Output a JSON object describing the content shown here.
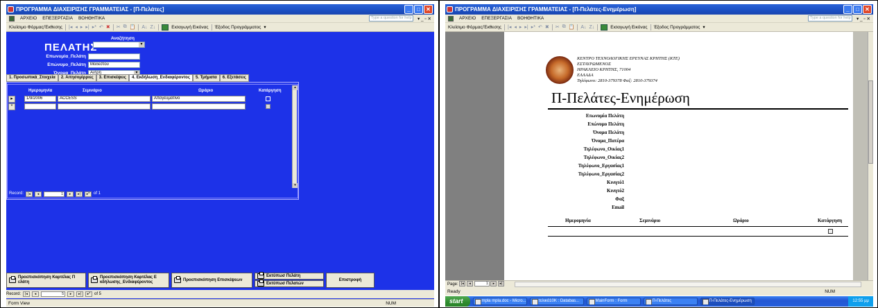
{
  "left": {
    "title": "ΠΡΟΓΡΑΜΜΑ ΔΙΑΧΕΙΡΙΣΗΣ ΓΡΑΜΜΑΤΕΙΑΣ - [Π-Πελάτες]",
    "menu": [
      "ΑΡΧΕΙΟ",
      "ΕΠΕΞΕΡΓΑΣΙΑ",
      "ΒΟΗΘΗΤΙΚΑ"
    ],
    "help_placeholder": "Type a question for help",
    "toolbar": {
      "close_label": "Κλείσιμο Φόρμας/Έκθεσης",
      "insert_image": "Εισαγωγή Εικόνας",
      "exit": "Έξοδος Προγράμματος"
    },
    "form": {
      "title": "ΠΕΛΑΤΗΣ",
      "autofind_label": "Αναζήτηση",
      "fields": [
        {
          "label": "Επωνυμία_Πελάτη",
          "value": ""
        },
        {
          "label": "Επώνυμο_Πελάτη",
          "value": "Μοδέστου"
        },
        {
          "label": "Όνομα_Πελάτη",
          "value": "Αντρη"
        }
      ]
    },
    "tabs": [
      "1. Προσωπικά_Στοιχεία",
      "2. Αιτησομίρριες",
      "3. Επισκέψεις",
      "4. Εκδήλωση_Ενδιαφέροντος",
      "5. Τμήματα",
      "6. Εξετάσεις"
    ],
    "active_tab": 3,
    "subform": {
      "columns": [
        "Ημερομηνία",
        "Σεμινάριο",
        "Ωράριο",
        "Κατάργηση"
      ],
      "rows": [
        {
          "date": "1/9/2006",
          "seminar": "ACCESS",
          "schedule": "Απογευματινό"
        }
      ],
      "record_label": "Record:",
      "record_num": "1",
      "record_of": "of 1"
    },
    "buttons": [
      "Προεπισκόπηση Καρτέλας Π ελάτη",
      "Προεπισκόπηση Καρτέλας Ε κδήλωσης_Ενδιαφέροντος",
      "Προεπισκόπηση Επισκέψεων",
      "Εκτύπωσ Πελάτη",
      "Εκτύπωσ Πελατών",
      "Επιστροφή"
    ],
    "record": {
      "label": "Record:",
      "num": "5",
      "of": "of 5"
    },
    "status": {
      "view": "Form View",
      "num": "NUM"
    }
  },
  "right": {
    "title": "ΠΡΟΓΡΑΜΜΑ ΔΙΑΧΕΙΡΙΣΗΣ ΓΡΑΜΜΑΤΕΙΑΣ - [Π-Πελάτες-Ενημέρωση]",
    "menu": [
      "ΑΡΧΕΙΟ",
      "ΕΠΕΞΕΡΓΑΣΙΑ",
      "ΒΟΗΘΗΤΙΚΑ"
    ],
    "help_placeholder": "Type a question for help",
    "toolbar": {
      "close_label": "Κλείσιμο Φόρμας/Έκθεσης",
      "insert_image": "Εισαγωγή Εικόνας",
      "exit": "Έξοδος Προγράμματος"
    },
    "org": [
      "ΚΕΝΤΡΟ ΤΕΧΝΟΛΟΓΙΚΗΣ ΕΡΕΥΝΑΣ ΚΡΗΤΗΣ (ΚΤΕ)",
      "ΕΣΤΑΥΡΩΜΕΝΟΣ",
      "ΗΡΑΚΛΕΙΟ ΚΡΗΤΗΣ, 71004",
      "ΕΛΛΑΔΑ",
      "Τηλέφωνο: 2810-379378 Φαξ: 2810-379374"
    ],
    "report_title": "Π-Πελάτες-Ενημέρωση",
    "fields": [
      "Επωνυμία Πελάτη",
      "Επώνυμο Πελάτη",
      "Όνομα Πελάτη",
      "Όνομα_Πατέρα",
      "Τηλέφωνο_Οικίας1",
      "Τηλέφωνο_Οικίας2",
      "Τηλέφωνο_Εργασίας1",
      "Τηλέφωνο_Εργασίας2",
      "Κινητό1",
      "Κινητό2",
      "Φαξ",
      "Email"
    ],
    "detail_headers": [
      "Ημερομηνία",
      "Σεμινάριο",
      "Ωράριο",
      "Κατάργηση"
    ],
    "page": {
      "label": "Page:",
      "num": "1"
    },
    "status": {
      "ready": "Ready",
      "num": "NUM"
    },
    "taskbar": {
      "start": "start",
      "tasks": [
        "mpla mpla.doc - Micro...",
        "τελικό10Κ : Databas...",
        "MainForm : Form",
        "Π-Πελάτες",
        "Π-Πελάτες-Ενημέρωση"
      ],
      "clock": "12:55 μμ"
    }
  }
}
